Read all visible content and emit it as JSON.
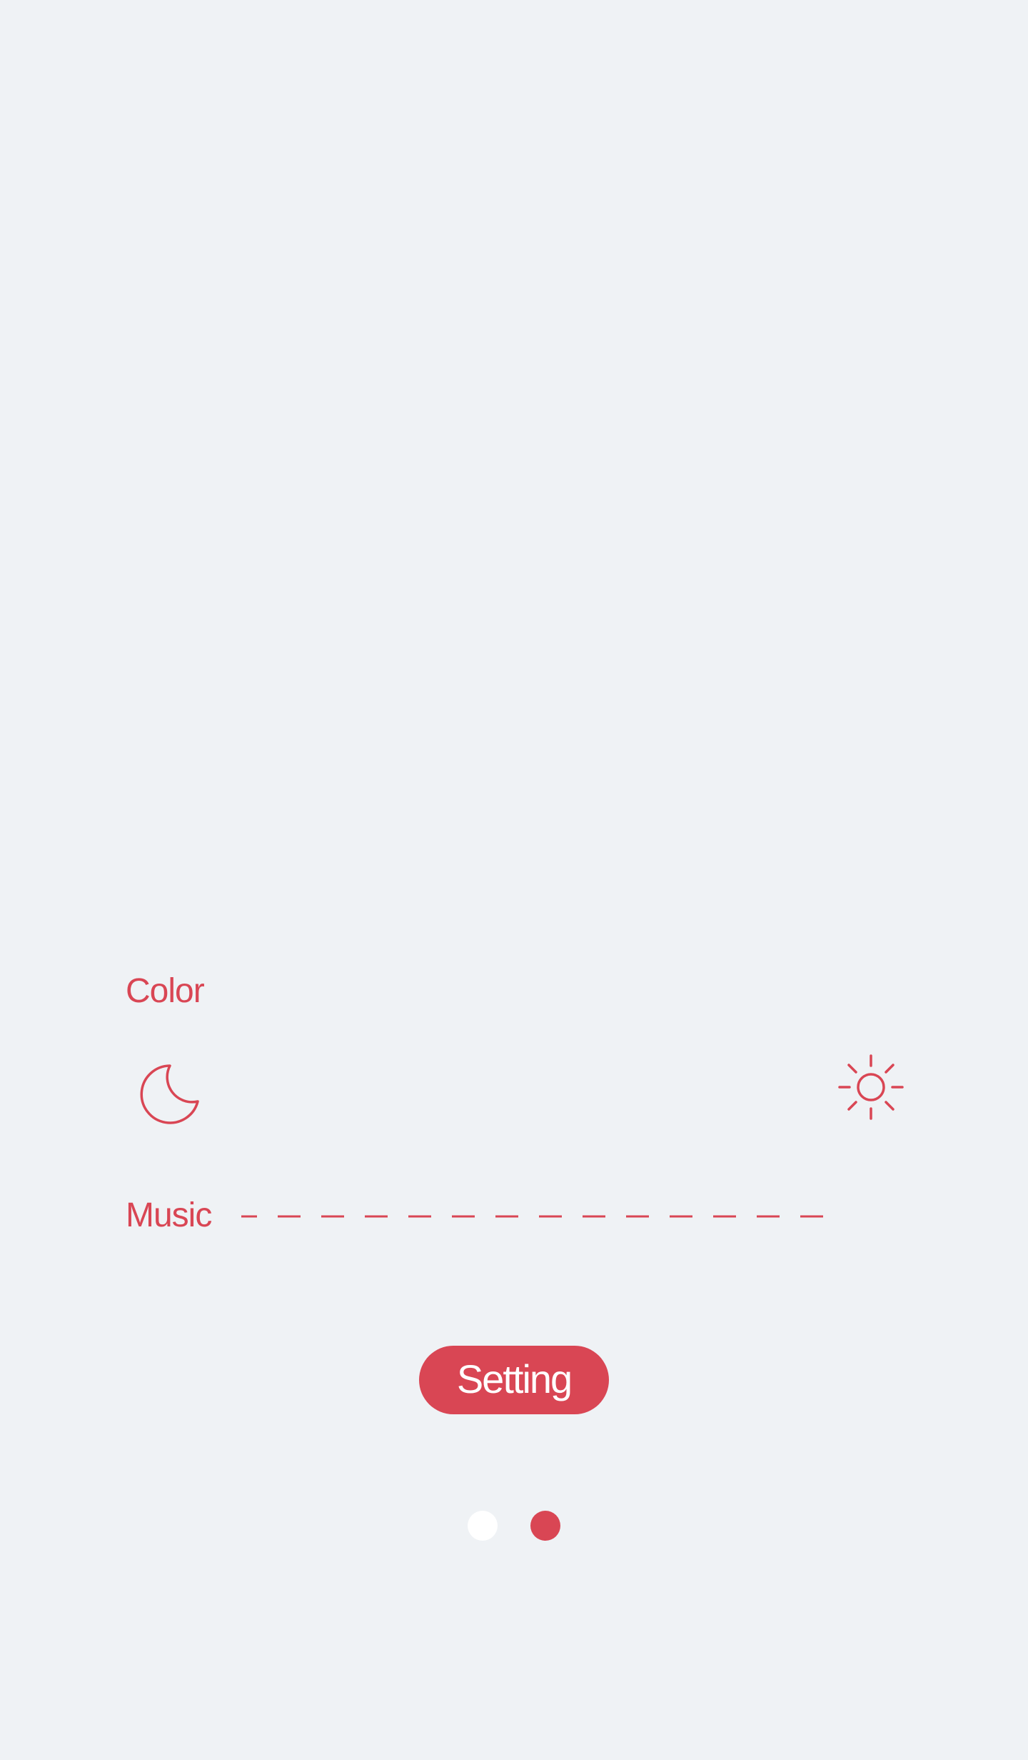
{
  "colors": {
    "background": "#eff2f5",
    "accent": "#d94654",
    "inactive_dot": "#ffffff"
  },
  "color_section": {
    "label": "Color",
    "left_icon": "moon-icon",
    "right_icon": "sun-icon"
  },
  "music_section": {
    "label": "Music",
    "slider_style": "dashed-line"
  },
  "setting_button": {
    "label": "Setting"
  },
  "pagination": {
    "page_count": 2,
    "active_page": 2
  }
}
